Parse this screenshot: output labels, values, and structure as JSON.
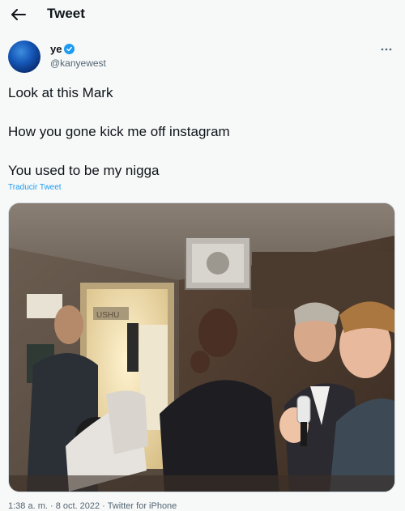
{
  "header": {
    "title": "Tweet"
  },
  "author": {
    "display_name": "ye",
    "handle": "@kanyewest"
  },
  "tweet": {
    "lines": [
      "Look at this Mark",
      "How you gone kick me off instagram",
      "You used to be my nigga"
    ],
    "translate_label": "Traducir Tweet"
  },
  "photo": {
    "sign_text": "USHU"
  },
  "meta": {
    "timestamp": "1:38 a. m. · 8 oct. 2022 · Twitter for iPhone"
  },
  "colors": {
    "accent": "#1d9bf0",
    "background": "#f7f9f9",
    "secondary_text": "#536471"
  },
  "icons": {
    "back": "arrow-left-icon",
    "verified": "verified-badge-icon",
    "more": "more-icon"
  }
}
